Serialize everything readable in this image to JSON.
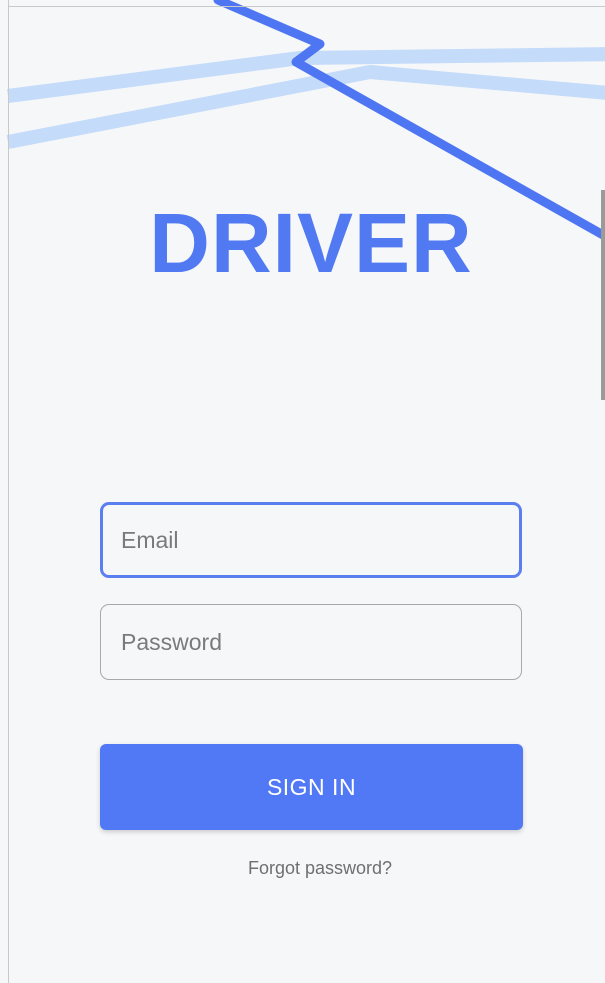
{
  "app": {
    "logo_text": "DRIVER"
  },
  "login_form": {
    "email_placeholder": "Email",
    "email_value": "",
    "password_placeholder": "Password",
    "password_value": "",
    "signin_label": "SIGN IN",
    "forgot_label": "Forgot password?"
  },
  "colors": {
    "brand": "#5179f2",
    "background": "#f6f7f9",
    "road_light": "#c4dbf9",
    "road_dark": "#4f76f2"
  }
}
